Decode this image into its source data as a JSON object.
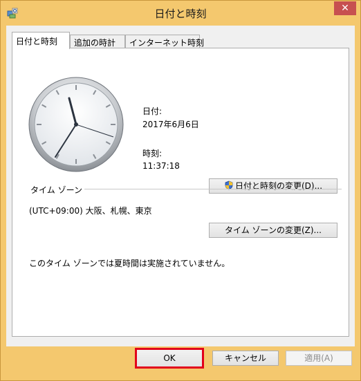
{
  "window": {
    "title": "日付と時刻",
    "close_label": "✕"
  },
  "tabs": [
    {
      "label": "日付と時刻",
      "active": true
    },
    {
      "label": "追加の時計",
      "active": false
    },
    {
      "label": "インターネット時刻",
      "active": false
    }
  ],
  "datetime": {
    "date_label": "日付:",
    "date_value": "2017年6月6日",
    "time_label": "時刻:",
    "time_value": "11:37:18",
    "change_button": "日付と時刻の変更(D)..."
  },
  "timezone": {
    "group_label": "タイム ゾーン",
    "value": "(UTC+09:00) 大阪、札幌、東京",
    "change_button": "タイム ゾーンの変更(Z)...",
    "dst_note": "このタイム ゾーンでは夏時間は実施されていません。"
  },
  "footer": {
    "ok_label": "OK",
    "cancel_label": "キャンセル",
    "apply_label": "適用(A)",
    "highlight_color": "#e2001a"
  },
  "colors": {
    "title_bar": "#f4c86e",
    "close_button": "#c75050"
  }
}
